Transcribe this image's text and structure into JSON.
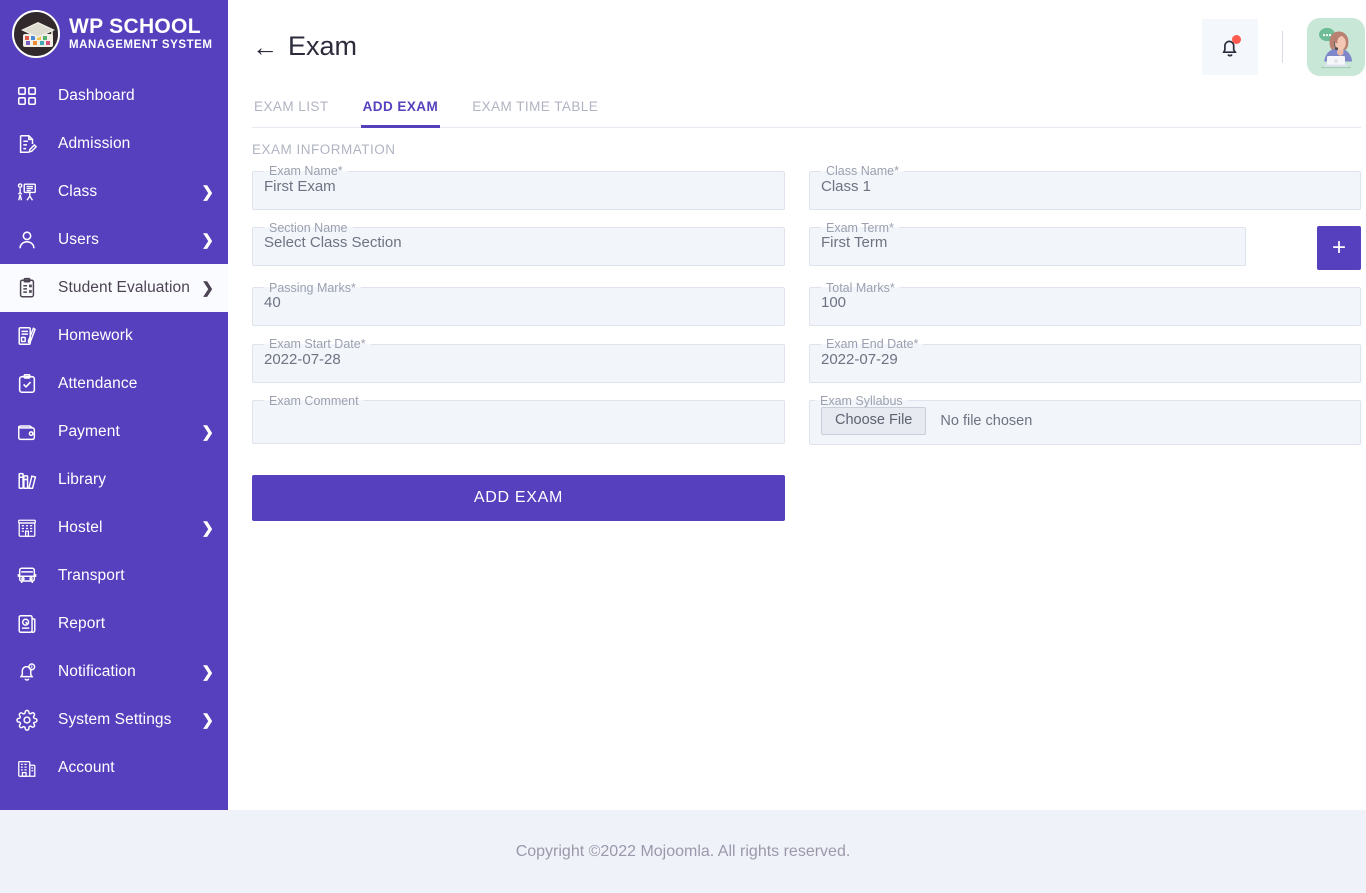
{
  "brand": {
    "title": "WP SCHOOL",
    "subtitle": "MANAGEMENT SYSTEM",
    "logo_icon": "graduation-cap-logo"
  },
  "sidebar": {
    "bg_color": "#5640bd",
    "active_bg_color": "#fafbfe",
    "items": [
      {
        "label": "Dashboard",
        "icon": "grid-icon",
        "chevron": "",
        "active": false
      },
      {
        "label": "Admission",
        "icon": "document-pen-icon",
        "chevron": "",
        "active": false
      },
      {
        "label": "Class",
        "icon": "classroom-icon",
        "chevron": "❯",
        "active": false
      },
      {
        "label": "Users",
        "icon": "user-icon",
        "chevron": "❯",
        "active": false
      },
      {
        "label": "Student Evaluation",
        "icon": "clipboard-check-icon",
        "chevron": "❯",
        "active": true
      },
      {
        "label": "Homework",
        "icon": "homework-icon",
        "chevron": "",
        "active": false
      },
      {
        "label": "Attendance",
        "icon": "clipboard-tick-icon",
        "chevron": "",
        "active": false
      },
      {
        "label": "Payment",
        "icon": "wallet-icon",
        "chevron": "❯",
        "active": false
      },
      {
        "label": "Library",
        "icon": "books-icon",
        "chevron": "",
        "active": false
      },
      {
        "label": "Hostel",
        "icon": "building-icon",
        "chevron": "❯",
        "active": false
      },
      {
        "label": "Transport",
        "icon": "bus-icon",
        "chevron": "",
        "active": false
      },
      {
        "label": "Report",
        "icon": "report-icon",
        "chevron": "",
        "active": false
      },
      {
        "label": "Notification",
        "icon": "bell-icon",
        "chevron": "❯",
        "active": false
      },
      {
        "label": "System Settings",
        "icon": "gear-icon",
        "chevron": "❯",
        "active": false
      },
      {
        "label": "Account",
        "icon": "account-building-icon",
        "chevron": "",
        "active": false
      }
    ]
  },
  "header": {
    "back_arrow": "←",
    "title": "Exam",
    "notification_icon": "bell-icon",
    "has_notification_badge": true,
    "avatar_icon": "support-agent-avatar"
  },
  "tabs": [
    {
      "label": "EXAM LIST",
      "active": false
    },
    {
      "label": "ADD EXAM",
      "active": true
    },
    {
      "label": "EXAM TIME TABLE",
      "active": false
    }
  ],
  "form": {
    "section_title": "EXAM INFORMATION",
    "fields": {
      "exam_name": {
        "label": "Exam Name*",
        "value": "First Exam"
      },
      "class_name": {
        "label": "Class Name*",
        "value": "Class 1"
      },
      "section_name": {
        "label": "Section Name",
        "value": "Select Class Section"
      },
      "exam_term": {
        "label": "Exam Term*",
        "value": "First Term"
      },
      "passing_marks": {
        "label": "Passing Marks*",
        "value": "40"
      },
      "total_marks": {
        "label": "Total Marks*",
        "value": "100"
      },
      "exam_start_date": {
        "label": "Exam Start Date*",
        "value": "2022-07-28"
      },
      "exam_end_date": {
        "label": "Exam End Date*",
        "value": "2022-07-29"
      },
      "exam_comment": {
        "label": "Exam Comment",
        "value": ""
      },
      "exam_syllabus": {
        "label": "Exam Syllabus",
        "choose_file_label": "Choose File",
        "file_status": "No file chosen"
      }
    },
    "add_term_button": "+",
    "submit_label": "ADD EXAM",
    "accent_color": "#5640bd"
  },
  "footer": {
    "text": "Copyright ©2022 Mojoomla. All rights reserved."
  }
}
